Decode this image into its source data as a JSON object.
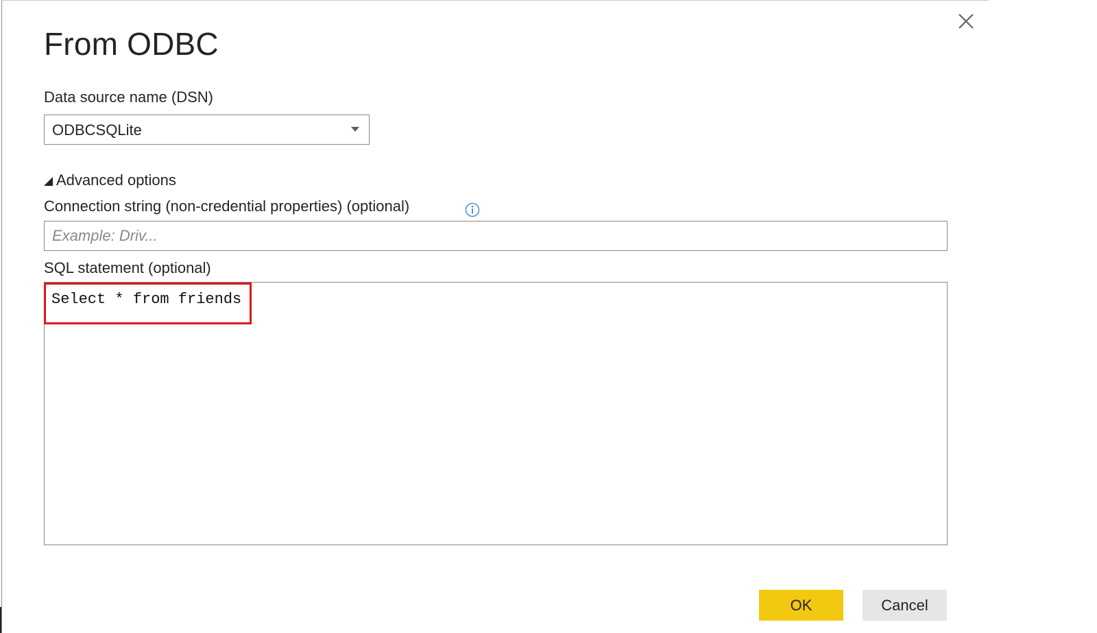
{
  "dialog": {
    "title": "From ODBC",
    "close_icon": "close-icon"
  },
  "dsn": {
    "label": "Data source name (DSN)",
    "selected": "ODBCSQLite"
  },
  "advanced": {
    "toggle_label": "Advanced options",
    "expanded": true,
    "connection_string": {
      "label": "Connection string (non-credential properties) (optional)",
      "placeholder": "Example: Driv...",
      "value": ""
    },
    "sql": {
      "label": "SQL statement (optional)",
      "value": "Select * from friends",
      "highlight_color": "#e0141e"
    }
  },
  "buttons": {
    "ok_label": "OK",
    "cancel_label": "Cancel",
    "ok_color": "#f2c811",
    "cancel_color": "#e6e6e6"
  }
}
